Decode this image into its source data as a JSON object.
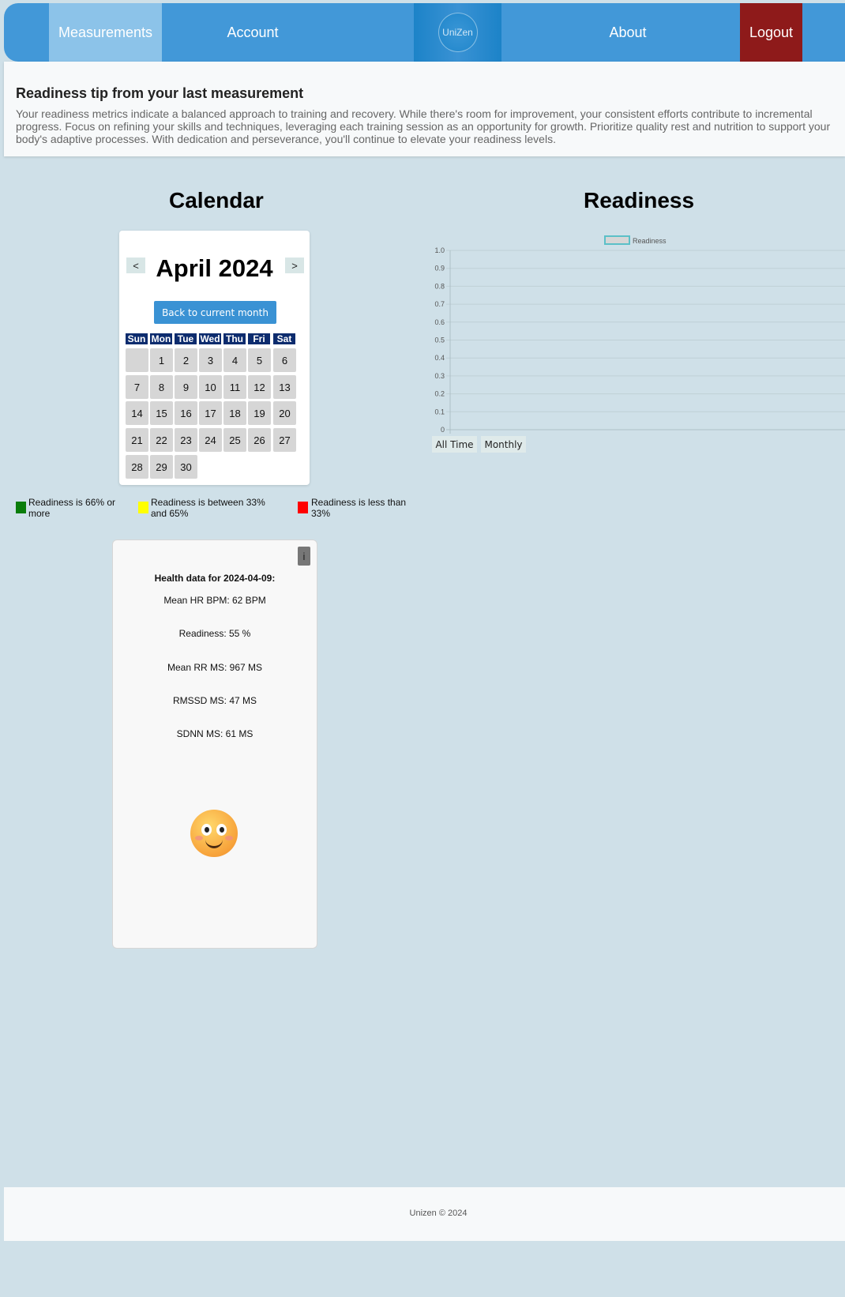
{
  "nav": {
    "measurements": "Measurements",
    "account": "Account",
    "logo": "UniZen",
    "about": "About",
    "logout": "Logout"
  },
  "tip": {
    "title": "Readiness tip from your last measurement",
    "text": "Your readiness metrics indicate a balanced approach to training and recovery. While there's room for improvement, your consistent efforts contribute to incremental progress. Focus on refining your skills and techniques, leveraging each training session as an opportunity for growth. Prioritize quality rest and nutrition to support your body's adaptive processes. With dedication and perseverance, you'll continue to elevate your readiness levels."
  },
  "calendar": {
    "title": "Calendar",
    "month": "April 2024",
    "prev": "<",
    "next": ">",
    "back": "Back to current month",
    "weekdays": [
      "Sun",
      "Mon",
      "Tue",
      "Wed",
      "Thu",
      "Fri",
      "Sat"
    ],
    "first_weekday_offset": 1,
    "days_in_month": 30
  },
  "legend": [
    {
      "label": "Readiness is 66% or more",
      "color": "#0a7d0a"
    },
    {
      "label": "Readiness is between 33% and 65%",
      "color": "#ffff00"
    },
    {
      "label": "Readiness is less than 33%",
      "color": "#ff0000"
    }
  ],
  "health": {
    "info": "i",
    "title": "Health data for 2024-04-09:",
    "mean_hr": "Mean HR BPM: 62 BPM",
    "readiness": "Readiness: 55 %",
    "mean_rr": "Mean RR MS: 967 MS",
    "rmssd": "RMSSD MS: 47 MS",
    "sdnn": "SDNN MS: 61 MS"
  },
  "chart_title": "Readiness",
  "chart_buttons": {
    "all_time": "All Time",
    "monthly": "Monthly"
  },
  "chart_data": {
    "type": "line",
    "title": "",
    "series": [
      {
        "name": "Readiness",
        "values": []
      }
    ],
    "x": [],
    "xlabel": "",
    "ylabel": "",
    "ylim": [
      0,
      1.0
    ],
    "yticks": [
      "1.0",
      "0.9",
      "0.8",
      "0.7",
      "0.6",
      "0.5",
      "0.4",
      "0.3",
      "0.2",
      "0.1",
      "0"
    ],
    "grid": true,
    "legend_position": "top",
    "series_color": "#5bc0c8"
  },
  "footer": "Unizen © 2024"
}
